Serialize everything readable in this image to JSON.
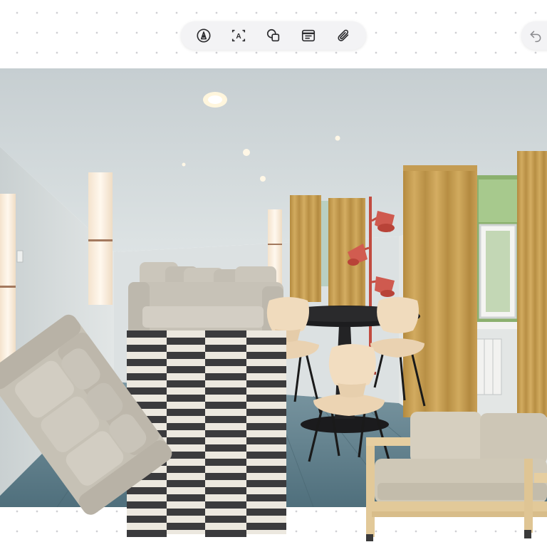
{
  "toolbar": {
    "tools": [
      {
        "name": "pen-tool",
        "icon": "pen-nib-icon"
      },
      {
        "name": "text-tool",
        "icon": "text-box-icon",
        "glyph": "A"
      },
      {
        "name": "shapes-tool",
        "icon": "shapes-icon"
      },
      {
        "name": "note-tool",
        "icon": "note-card-icon"
      },
      {
        "name": "attachment-tool",
        "icon": "paperclip-icon"
      }
    ],
    "undo_icon": "undo-arrow-icon"
  },
  "colors": {
    "background": "#ffffff",
    "grid_dots": "#cfcfd3",
    "toolbar_bg": "#f3f3f5",
    "icon": "#2b2b2e",
    "wall": "#d9dfe0",
    "ceiling": "#cdd4d6",
    "floor": "#5f7f8c",
    "curtain": "#c39a4c",
    "sofa": "#cfcac0",
    "lamp_red": "#c9544a",
    "table_black": "#1d1d1f",
    "chair_wood": "#f1dcc0",
    "birch": "#e8d3a9",
    "rug_dark": "#3b3b3d",
    "rug_light": "#ece8df"
  },
  "board": {
    "items": [
      {
        "name": "room-photo",
        "kind": "photo"
      },
      {
        "name": "tilted-sofa-cutout",
        "kind": "sticker"
      },
      {
        "name": "striped-rug-cutout",
        "kind": "sticker"
      },
      {
        "name": "dining-table-cutout",
        "kind": "sticker"
      },
      {
        "name": "dining-chair-cutout",
        "kind": "sticker"
      },
      {
        "name": "floor-lamp-cutout",
        "kind": "sticker"
      },
      {
        "name": "curtain-cutout",
        "kind": "sticker"
      },
      {
        "name": "loveseat-cutout",
        "kind": "sticker"
      }
    ]
  }
}
